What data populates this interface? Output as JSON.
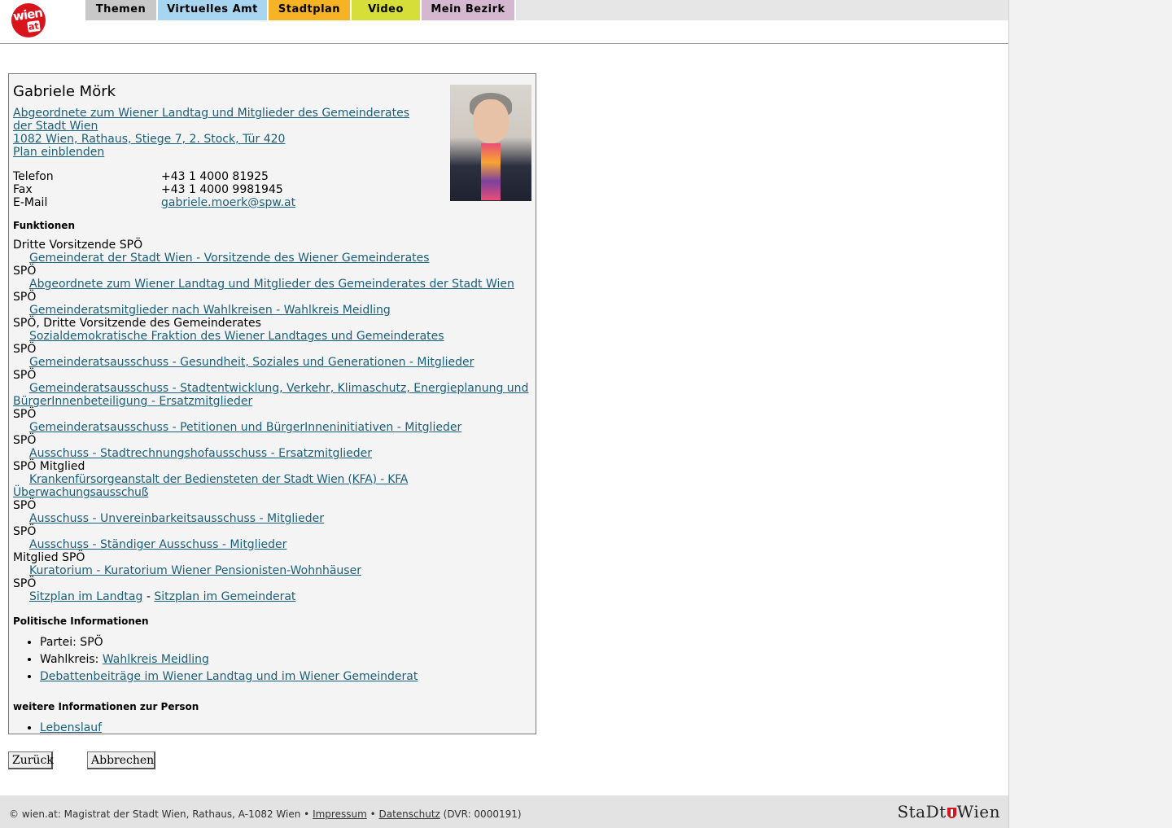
{
  "logo": {
    "word": "wien",
    "tld": "at"
  },
  "nav": {
    "tabs": [
      {
        "label": "Themen",
        "color": "#c8c8c8"
      },
      {
        "label": "Virtuelles Amt",
        "color": "#a8d6f0"
      },
      {
        "label": "Stadtplan",
        "color": "#f5b325"
      },
      {
        "label": "Video",
        "color": "#d6de3a"
      },
      {
        "label": "Mein Bezirk",
        "color": "#d4b8cf"
      }
    ]
  },
  "person": {
    "name": "Gabriele Mörk",
    "org_link": "Abgeordnete zum Wiener Landtag und Mitglieder des Gemeinderates der Stadt Wien ",
    "address_link": "1082 Wien, Rathaus, Stiege 7, 2. Stock, Tür 420",
    "plan_link": "Plan einblenden",
    "contact": [
      {
        "label": "Telefon",
        "value": "+43 1 4000 81925"
      },
      {
        "label": "Fax",
        "value": "+43 1 4000 9981945"
      },
      {
        "label": "E-Mail",
        "value": "gabriele.moerk@spw.at"
      }
    ]
  },
  "funktionen": {
    "heading": "Funktionen",
    "items": [
      {
        "prefix": "Dritte Vorsitzende SPÖ",
        "link": "Gemeinderat der Stadt Wien - Vorsitzende des Wiener Gemeinderates"
      },
      {
        "prefix": "SPÖ",
        "link": "Abgeordnete zum Wiener Landtag und Mitglieder des Gemeinderates der Stadt Wien"
      },
      {
        "prefix": "SPÖ",
        "link": "Gemeinderatsmitglieder nach Wahlkreisen - Wahlkreis Meidling"
      },
      {
        "prefix": "SPÖ, Dritte Vorsitzende des Gemeinderates",
        "link": "Sozialdemokratische Fraktion des Wiener Landtages und Gemeinderates"
      },
      {
        "prefix": "SPÖ",
        "link": "Gemeinderatsausschuss - Gesundheit, Soziales und Generationen - Mitglieder"
      },
      {
        "prefix": "SPÖ",
        "link": "Gemeinderatsausschuss - Stadtentwicklung, Verkehr, Klimaschutz, Energieplanung und BürgerInnenbeteiligung - Ersatzmitglieder"
      },
      {
        "prefix": "SPÖ",
        "link": "Gemeinderatsausschuss - Petitionen und BürgerInneninitiativen - Mitglieder"
      },
      {
        "prefix": "SPÖ",
        "link": "Ausschuss - Stadtrechnungshofausschuss - Ersatzmitglieder"
      },
      {
        "prefix": "SPÖ Mitglied",
        "link": "Krankenfürsorgeanstalt der Bediensteten der Stadt Wien (KFA) - KFA Überwachungsausschuß"
      },
      {
        "prefix": "SPÖ",
        "link": "Ausschuss - Unvereinbarkeitsausschuss - Mitglieder"
      },
      {
        "prefix": "SPÖ",
        "link": "Ausschuss - Ständiger Ausschuss - Mitglieder"
      },
      {
        "prefix": "Mitglied SPÖ",
        "link": "Kuratorium - Kuratorium Wiener Pensionisten-Wohnhäuser"
      }
    ],
    "last_prefix": "SPÖ",
    "sitzplan_landtag": "Sitzplan im Landtag",
    "separator": " - ",
    "sitzplan_gemeinderat": "Sitzplan im Gemeinderat"
  },
  "politisch": {
    "heading": "Politische Informationen",
    "partei_label": "Partei: SPÖ",
    "wahlkreis_label": "Wahlkreis: ",
    "wahlkreis_link": "Wahlkreis Meidling",
    "debatten_link": "Debattenbeiträge im Wiener Landtag und im Wiener Gemeinderat"
  },
  "weitere": {
    "heading": "weitere Informationen zur Person",
    "lebenslauf_link": "Lebenslauf"
  },
  "buttons": {
    "back": "Zurück",
    "cancel": "Abbrechen"
  },
  "footer": {
    "copyright": "© wien.at: Magistrat der Stadt Wien, Rathaus, A-1082 Wien",
    "bullet": " • ",
    "impressum": "Impressum",
    "datenschutz": "Datenschutz",
    "dvr": " (DVR: 0000191)",
    "brand_left": "StaDt",
    "brand_right": "Wien"
  }
}
